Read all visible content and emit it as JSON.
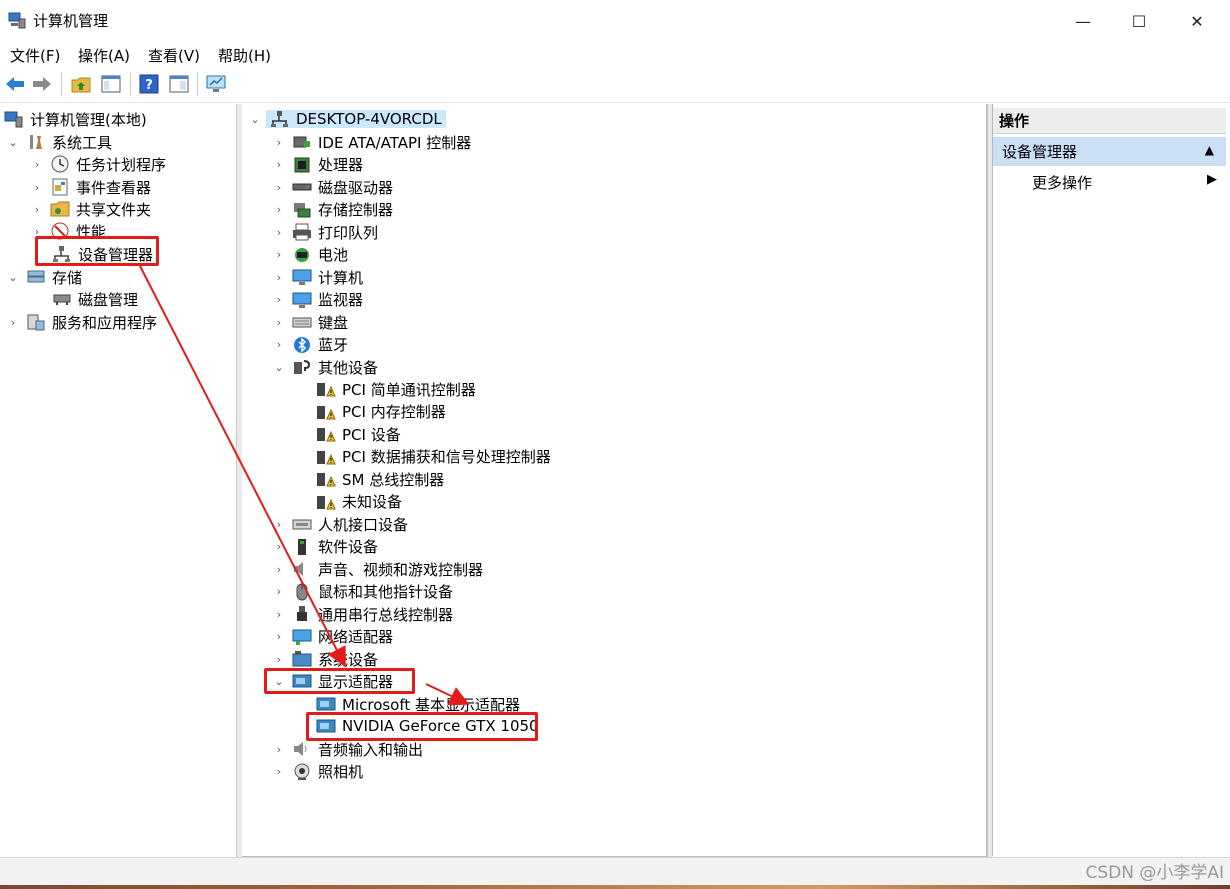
{
  "window": {
    "title": "计算机管理",
    "minimize_glyph": "—",
    "maximize_glyph": "☐",
    "close_glyph": "✕"
  },
  "menu": [
    "文件(F)",
    "操作(A)",
    "查看(V)",
    "帮助(H)"
  ],
  "toolbar": [
    "back-arrow-icon",
    "forward-arrow-icon",
    "up-folder-icon",
    "show-hide-tree-icon",
    "help-icon",
    "properties-icon",
    "monitor-icon"
  ],
  "left_tree": {
    "root": "计算机管理(本地)",
    "system_tools": "系统工具",
    "task_scheduler": "任务计划程序",
    "event_viewer": "事件查看器",
    "shared_folders": "共享文件夹",
    "performance": "性能",
    "device_manager": "设备管理器",
    "storage": "存储",
    "disk_management": "磁盘管理",
    "services": "服务和应用程序"
  },
  "device_tree": {
    "root": "DESKTOP-4VORCDL",
    "categories": [
      {
        "label": "IDE ATA/ATAPI 控制器",
        "icon": "ide-controller-icon"
      },
      {
        "label": "处理器",
        "icon": "processor-icon"
      },
      {
        "label": "磁盘驱动器",
        "icon": "disk-drive-icon"
      },
      {
        "label": "存储控制器",
        "icon": "storage-controller-icon"
      },
      {
        "label": "打印队列",
        "icon": "printer-icon"
      },
      {
        "label": "电池",
        "icon": "battery-icon"
      },
      {
        "label": "计算机",
        "icon": "computer-icon"
      },
      {
        "label": "监视器",
        "icon": "monitor-icon"
      },
      {
        "label": "键盘",
        "icon": "keyboard-icon"
      },
      {
        "label": "蓝牙",
        "icon": "bluetooth-icon"
      },
      {
        "label": "其他设备",
        "icon": "other-devices-icon"
      }
    ],
    "other_devices": [
      "PCI 简单通讯控制器",
      "PCI 内存控制器",
      "PCI 设备",
      "PCI 数据捕获和信号处理控制器",
      "SM 总线控制器",
      "未知设备"
    ],
    "categories2": [
      {
        "label": "人机接口设备",
        "icon": "hid-icon"
      },
      {
        "label": "软件设备",
        "icon": "software-device-icon"
      },
      {
        "label": "声音、视频和游戏控制器",
        "icon": "sound-icon"
      },
      {
        "label": "鼠标和其他指针设备",
        "icon": "mouse-icon"
      },
      {
        "label": "通用串行总线控制器",
        "icon": "usb-icon"
      },
      {
        "label": "网络适配器",
        "icon": "network-adapter-icon"
      },
      {
        "label": "系统设备",
        "icon": "system-device-icon"
      }
    ],
    "display_adapters": "显示适配器",
    "display_children": [
      "Microsoft 基本显示适配器",
      "NVIDIA GeForce GTX 1050"
    ],
    "categories3": [
      {
        "label": "音频输入和输出",
        "icon": "audio-io-icon"
      },
      {
        "label": "照相机",
        "icon": "camera-icon"
      }
    ]
  },
  "actions": {
    "header": "操作",
    "group": "设备管理器",
    "more": "更多操作"
  },
  "watermark": "CSDN @小李学AI",
  "colors": {
    "annotation_red": "#e31b1b",
    "selection_blue": "#cce8ff",
    "actions_group_blue": "#c9dff3"
  }
}
